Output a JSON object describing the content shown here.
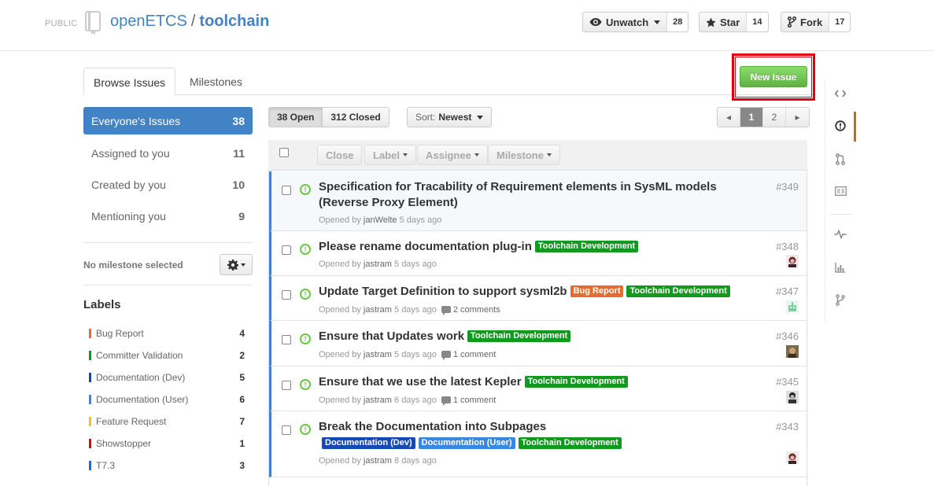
{
  "repo": {
    "visibility": "PUBLIC",
    "owner": "openETCS",
    "separator": "/",
    "name": "toolchain"
  },
  "actions": {
    "watch": {
      "label": "Unwatch",
      "count": "28"
    },
    "star": {
      "label": "Star",
      "count": "14"
    },
    "fork": {
      "label": "Fork",
      "count": "17"
    }
  },
  "tabs": {
    "browse": "Browse Issues",
    "milestones": "Milestones"
  },
  "new_issue": "New Issue",
  "filters": [
    {
      "label": "Everyone's Issues",
      "count": "38"
    },
    {
      "label": "Assigned to you",
      "count": "11"
    },
    {
      "label": "Created by you",
      "count": "10"
    },
    {
      "label": "Mentioning you",
      "count": "9"
    }
  ],
  "milestone": "No milestone selected",
  "labels_heading": "Labels",
  "labels": [
    {
      "name": "Bug Report",
      "count": "4",
      "color": "#e86a2f"
    },
    {
      "name": "Committer Validation",
      "count": "2",
      "color": "#12991f"
    },
    {
      "name": "Documentation (Dev)",
      "count": "5",
      "color": "#1549b7"
    },
    {
      "name": "Documentation (User)",
      "count": "6",
      "color": "#3a87e0"
    },
    {
      "name": "Feature Request",
      "count": "7",
      "color": "#f3c21b"
    },
    {
      "name": "Showstopper",
      "count": "1",
      "color": "#d60e0e"
    },
    {
      "name": "T7.3",
      "count": "3",
      "color": "#1a6be0"
    }
  ],
  "state": {
    "open": "38 Open",
    "closed": "312 Closed"
  },
  "sort": {
    "prefix": "Sort:",
    "value": "Newest"
  },
  "pagination": {
    "prev": "◂",
    "pages": [
      "1",
      "2"
    ],
    "next": "▸",
    "current": "1"
  },
  "bulk_actions": {
    "close": "Close",
    "label": "Label",
    "assignee": "Assignee",
    "milestone": "Milestone"
  },
  "issues": [
    {
      "title": "Specification for Tracability of Requirement elements in SysML models (Reverse Proxy Element)",
      "number": "#349",
      "opened_prefix": "Opened by",
      "author": "janWelte",
      "age": "5 days ago",
      "comments": "",
      "labels": []
    },
    {
      "title": "Please rename documentation plug-in",
      "number": "#348",
      "opened_prefix": "Opened by",
      "author": "jastram",
      "age": "5 days ago",
      "comments": "",
      "labels": [
        "Toolchain Development"
      ]
    },
    {
      "title": "Update Target Definition to support sysml2b",
      "number": "#347",
      "opened_prefix": "Opened by",
      "author": "jastram",
      "age": "5 days ago",
      "comments": "2 comments",
      "labels": [
        "Bug Report",
        "Toolchain Development"
      ]
    },
    {
      "title": "Ensure that Updates work",
      "number": "#346",
      "opened_prefix": "Opened by",
      "author": "jastram",
      "age": "5 days ago",
      "comments": "1 comment",
      "labels": [
        "Toolchain Development"
      ]
    },
    {
      "title": "Ensure that we use the latest Kepler",
      "number": "#345",
      "opened_prefix": "Opened by",
      "author": "jastram",
      "age": "6 days ago",
      "comments": "1 comment",
      "labels": [
        "Toolchain Development"
      ]
    },
    {
      "title": "Break the Documentation into Subpages",
      "number": "#343",
      "opened_prefix": "Opened by",
      "author": "jastram",
      "age": "8 days ago",
      "comments": "",
      "labels": [
        "Documentation (Dev)",
        "Documentation (User)",
        "Toolchain Development"
      ]
    }
  ],
  "label_colors": {
    "Toolchain Development": "#12991f",
    "Bug Report": "#e86a2f",
    "Documentation (Dev)": "#1549b7",
    "Documentation (User)": "#3a87e0"
  },
  "colors": {
    "accent": "#4183c4",
    "open_green": "#6cc644",
    "button_green": "#60b044",
    "highlight_red": "#e2000f",
    "rail_active": "#d26911"
  }
}
